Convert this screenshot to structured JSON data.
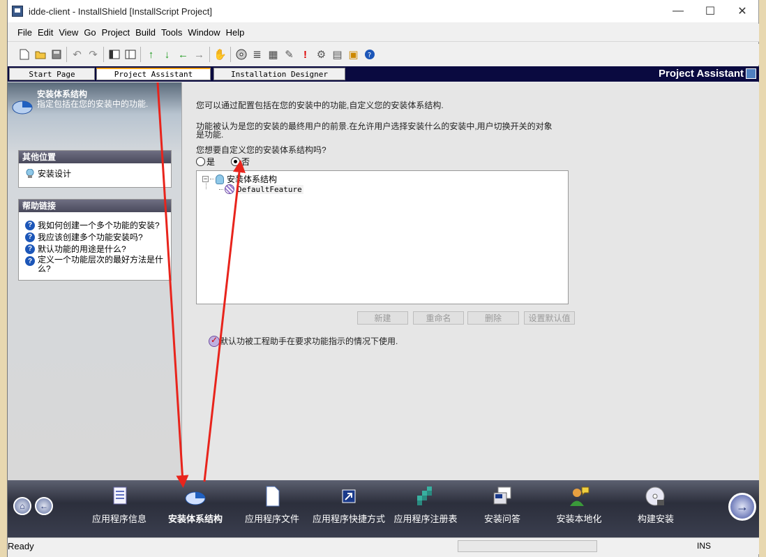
{
  "window": {
    "title": "idde-client - InstallShield [InstallScript Project]",
    "controls": {
      "minimize": "—",
      "maximize": "☐",
      "close": "✕"
    }
  },
  "menu": [
    "File",
    "Edit",
    "View",
    "Go",
    "Project",
    "Build",
    "Tools",
    "Window",
    "Help"
  ],
  "toolbar": {
    "icons": [
      "new-file-icon",
      "open-folder-icon",
      "save-icon",
      "undo-icon",
      "redo-icon",
      "panel-left-icon",
      "panel-split-icon",
      "arrow-up-icon",
      "arrow-down-icon",
      "arrow-left-icon",
      "arrow-right-icon",
      "wand-icon",
      "cd-icon",
      "build-icon",
      "calendar-icon",
      "tools-icon",
      "alert-icon",
      "gear-icon",
      "debug-icon",
      "package-icon",
      "help-icon"
    ]
  },
  "tabs": [
    "Start Page",
    "Project Assistant",
    "Installation Designer"
  ],
  "active_tab": "Project Assistant",
  "header_right_title": "Project Assistant",
  "left_panel": {
    "title": "安装体系结构",
    "subtitle": "指定包括在您的安装中的功能.",
    "other_places": {
      "heading": "其他位置",
      "items": [
        "安装设计"
      ]
    },
    "help_links": {
      "heading": "帮助链接",
      "items": [
        "我如何创建一个多个功能的安装?",
        "我应该创建多个功能安装吗?",
        "默认功能的用途是什么?",
        "定义一个功能层次的最好方法是什么?"
      ]
    }
  },
  "content": {
    "intro": "您可以通过配置包括在您的安装中的功能,自定义您的安装体系结构.",
    "description_line1": "功能被认为是您的安装的最终用户的前景.在允许用户选择安装什么的安装中,用户切换开关的对象",
    "description_line2": "是功能.",
    "question": "您想要自定义您的安装体系结构吗?",
    "radio_yes": "是",
    "radio_no": "否",
    "selected": "否",
    "tree": {
      "root": "安装体系结构",
      "children": [
        "DefaultFeature"
      ]
    },
    "buttons": [
      "新建",
      "重命名",
      "删除",
      "设置默认值"
    ],
    "note": "默认功被工程助手在要求功能指示的情况下使用."
  },
  "bottom_nav": {
    "items": [
      "应用程序信息",
      "安装体系结构",
      "应用程序文件",
      "应用程序快捷方式",
      "应用程序注册表",
      "安装问答",
      "安装本地化",
      "构建安装"
    ],
    "active": "安装体系结构"
  },
  "status": {
    "text": "Ready",
    "mode": "INS"
  },
  "colors": {
    "accent": "#f2a31a",
    "annotation_arrow": "#e8241c",
    "nav_bg": "#2c2f3c"
  }
}
